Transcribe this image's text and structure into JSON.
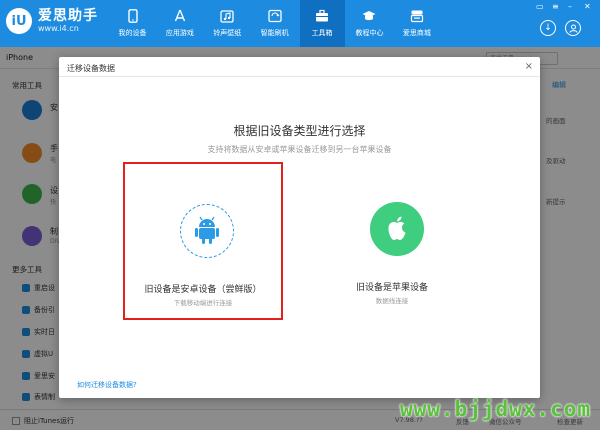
{
  "app": {
    "name": "爱思助手",
    "url": "www.i4.cn"
  },
  "nav": {
    "items": [
      {
        "label": "我的设备",
        "icon": "phone-icon"
      },
      {
        "label": "应用游戏",
        "icon": "app-store-icon"
      },
      {
        "label": "铃声壁纸",
        "icon": "music-wallpaper-icon"
      },
      {
        "label": "智能刷机",
        "icon": "flash-icon"
      },
      {
        "label": "工具箱",
        "icon": "toolbox-icon",
        "active": true
      },
      {
        "label": "教程中心",
        "icon": "graduation-cap-icon"
      },
      {
        "label": "爱思商城",
        "icon": "shop-icon"
      }
    ]
  },
  "device": {
    "name": "iPhone"
  },
  "search": {
    "placeholder": "查找工具"
  },
  "sidebar": {
    "section1": "常用工具",
    "tools": [
      {
        "name": "安",
        "sub": ""
      },
      {
        "name": "手",
        "sub": "电"
      },
      {
        "name": "设",
        "sub": "快"
      },
      {
        "name": "制",
        "sub": "DIV"
      }
    ],
    "section2": "更多工具",
    "items": [
      "重启设",
      "备份引",
      "实时日",
      "虚拟U",
      "爱思安",
      "表情制",
      "修复应"
    ]
  },
  "right": {
    "edit": "编辑",
    "texts": [
      "的画面",
      "及驱动",
      "新提示"
    ]
  },
  "footer": {
    "itunes": "阻止iTunes运行",
    "version": "V7.98.??",
    "feedback": "反馈",
    "wechat": "微信公众号",
    "update": "检查更新"
  },
  "dialog": {
    "title": "迁移设备数据",
    "close": "×",
    "heading": "根据旧设备类型进行选择",
    "subheading": "支持将数据从安卓或苹果设备迁移到另一台苹果设备",
    "options": [
      {
        "label": "旧设备是安卓设备（尝鲜版）",
        "hint": "下载移动端进行连接",
        "icon": "android-icon",
        "selected": true
      },
      {
        "label": "旧设备是苹果设备",
        "hint": "数据线连接",
        "icon": "apple-icon",
        "selected": false
      }
    ],
    "help": "如何迁移设备数据?"
  },
  "watermark": "www.bjjdwx.com",
  "colors": {
    "brand": "#1d8ce0",
    "highlight": "#e2201e",
    "apple_green": "#3fcd7f",
    "watermark": "#59c23a"
  }
}
